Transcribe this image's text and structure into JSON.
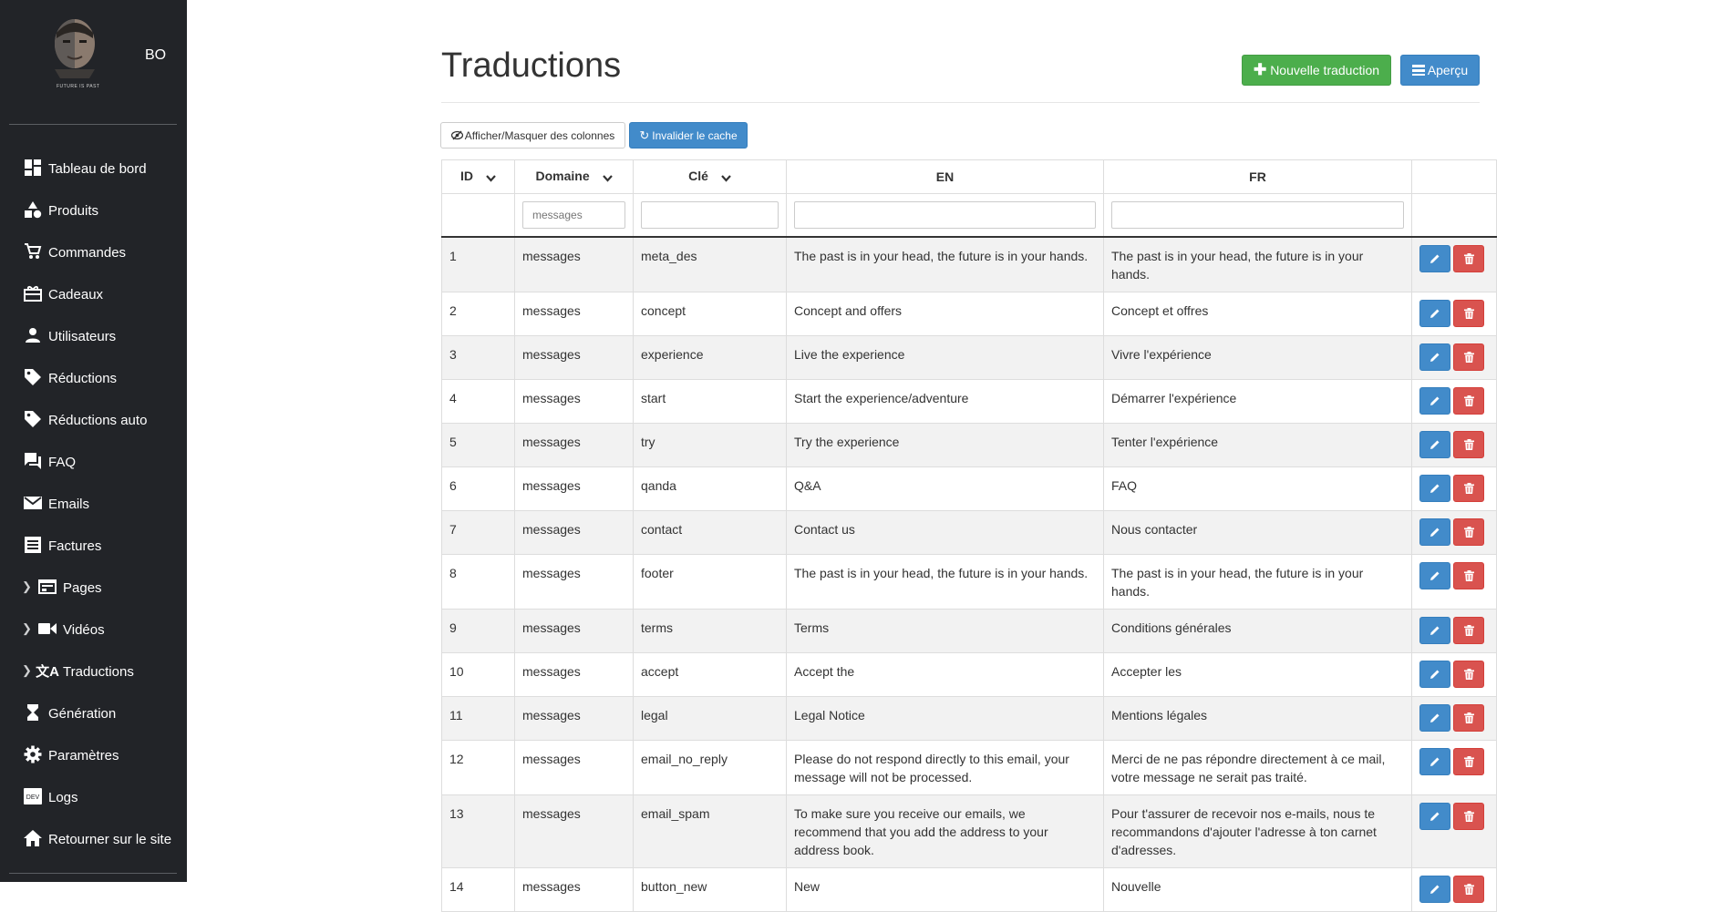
{
  "sidebar": {
    "brand": "BO",
    "logo_caption": "FUTURE IS PAST",
    "items": [
      {
        "label": "Tableau de bord",
        "icon": "dashboard-icon",
        "expandable": false
      },
      {
        "label": "Produits",
        "icon": "shapes-icon",
        "expandable": false
      },
      {
        "label": "Commandes",
        "icon": "cart-icon",
        "expandable": false
      },
      {
        "label": "Cadeaux",
        "icon": "gift-icon",
        "expandable": false
      },
      {
        "label": "Utilisateurs",
        "icon": "user-icon",
        "expandable": false
      },
      {
        "label": "Réductions",
        "icon": "tag-icon",
        "expandable": false
      },
      {
        "label": "Réductions auto",
        "icon": "tag-icon",
        "expandable": false
      },
      {
        "label": "FAQ",
        "icon": "forum-icon",
        "expandable": false
      },
      {
        "label": "Emails",
        "icon": "mail-icon",
        "expandable": false
      },
      {
        "label": "Factures",
        "icon": "invoice-icon",
        "expandable": false
      },
      {
        "label": "Pages",
        "icon": "web-page-icon",
        "expandable": true
      },
      {
        "label": "Vidéos",
        "icon": "video-camera-icon",
        "expandable": true
      },
      {
        "label": "Traductions",
        "icon": "translate-icon",
        "expandable": true
      },
      {
        "label": "Génération",
        "icon": "hourglass-icon",
        "expandable": false
      },
      {
        "label": "Paramètres",
        "icon": "gear-icon",
        "expandable": false
      },
      {
        "label": "Logs",
        "icon": "dev-icon",
        "expandable": false
      },
      {
        "label": "Retourner sur le site",
        "icon": "home-icon",
        "expandable": false
      }
    ]
  },
  "page": {
    "title": "Traductions",
    "new_button": "Nouvelle traduction",
    "preview_button": "Aperçu",
    "columns_toggle_button": "Afficher/Masquer des colonnes",
    "cache_button": "Invalider le cache"
  },
  "table": {
    "headers": {
      "id": "ID",
      "domain": "Domaine",
      "key": "Clé",
      "en": "EN",
      "fr": "FR"
    },
    "filters": {
      "domain_placeholder": "messages",
      "key_value": "",
      "en_value": "",
      "fr_value": ""
    },
    "rows": [
      {
        "id": "1",
        "domain": "messages",
        "key": "meta_des",
        "en": "The past is in your head, the future is in your hands.",
        "fr": "The past is in your head, the future is in your hands."
      },
      {
        "id": "2",
        "domain": "messages",
        "key": "concept",
        "en": "Concept and offers",
        "fr": "Concept et offres"
      },
      {
        "id": "3",
        "domain": "messages",
        "key": "experience",
        "en": "Live the experience",
        "fr": "Vivre l'expérience"
      },
      {
        "id": "4",
        "domain": "messages",
        "key": "start",
        "en": "Start the experience/adventure",
        "fr": "Démarrer l'expérience"
      },
      {
        "id": "5",
        "domain": "messages",
        "key": "try",
        "en": "Try the experience",
        "fr": "Tenter l'expérience"
      },
      {
        "id": "6",
        "domain": "messages",
        "key": "qanda",
        "en": "Q&A",
        "fr": "FAQ"
      },
      {
        "id": "7",
        "domain": "messages",
        "key": "contact",
        "en": "Contact us",
        "fr": "Nous contacter"
      },
      {
        "id": "8",
        "domain": "messages",
        "key": "footer",
        "en": "The past is in your head, the future is in your hands.",
        "fr": "The past is in your head, the future is in your hands."
      },
      {
        "id": "9",
        "domain": "messages",
        "key": "terms",
        "en": "Terms",
        "fr": "Conditions générales"
      },
      {
        "id": "10",
        "domain": "messages",
        "key": "accept",
        "en": "Accept the",
        "fr": "Accepter les"
      },
      {
        "id": "11",
        "domain": "messages",
        "key": "legal",
        "en": "Legal Notice",
        "fr": "Mentions légales"
      },
      {
        "id": "12",
        "domain": "messages",
        "key": "email_no_reply",
        "en": "Please do not respond directly to this email, your message will not be processed.",
        "fr": "Merci de ne pas répondre directement à ce mail, votre message ne serait pas traité."
      },
      {
        "id": "13",
        "domain": "messages",
        "key": "email_spam",
        "en": "To make sure you receive our emails, we recommend that you add the address to your address book.",
        "fr": "Pour t'assurer de recevoir nos e-mails, nous te recommandons d'ajouter l'adresse à ton carnet d'adresses."
      },
      {
        "id": "14",
        "domain": "messages",
        "key": "button_new",
        "en": "New",
        "fr": "Nouvelle"
      }
    ]
  },
  "colors": {
    "sidebar_bg": "#222428",
    "success": "#5cb85c",
    "primary": "#428bca",
    "danger": "#d9534f",
    "stripe": "#f2f2f2"
  }
}
